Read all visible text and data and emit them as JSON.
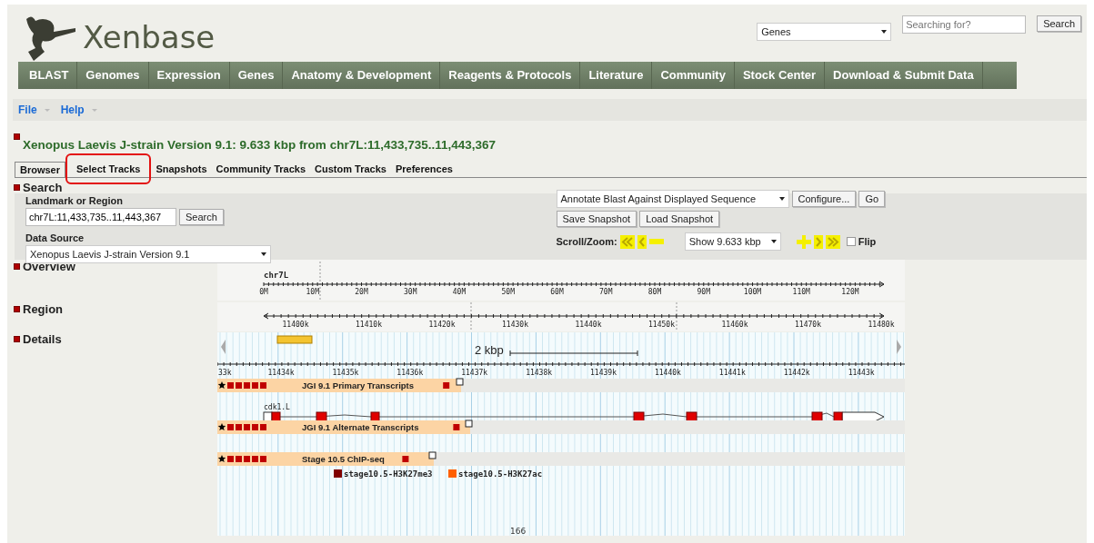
{
  "header": {
    "logo_text": "Xenbase",
    "category": "Genes",
    "search_placeholder": "Searching for?",
    "search_button": "Search"
  },
  "nav": [
    "BLAST",
    "Genomes",
    "Expression",
    "Genes",
    "Anatomy & Development",
    "Reagents & Protocols",
    "Literature",
    "Community",
    "Stock Center",
    "Download & Submit Data"
  ],
  "menu": [
    "File",
    "Help"
  ],
  "title": "Xenopus Laevis J-strain Version 9.1: 9.633 kbp from chr7L:11,433,735..11,443,367",
  "tabs": [
    {
      "label": "Browser",
      "selected": true,
      "highlighted": false
    },
    {
      "label": "Select Tracks",
      "selected": false,
      "highlighted": true
    },
    {
      "label": "Snapshots",
      "selected": false,
      "highlighted": false
    },
    {
      "label": "Community Tracks",
      "selected": false,
      "highlighted": false
    },
    {
      "label": "Custom Tracks",
      "selected": false,
      "highlighted": false
    },
    {
      "label": "Preferences",
      "selected": false,
      "highlighted": false
    }
  ],
  "search": {
    "title": "Search",
    "landmark_label": "Landmark or Region",
    "landmark_value": "chr7L:11,433,735..11,443,367",
    "search_button": "Search",
    "source_label": "Data Source",
    "source_value": "Xenopus Laevis J-strain Version 9.1",
    "annotate_value": "Annotate Blast Against Displayed Sequence",
    "configure_button": "Configure...",
    "go_button": "Go",
    "save_button": "Save Snapshot",
    "load_button": "Load Snapshot",
    "scroll_label": "Scroll/Zoom:",
    "zoom_value": "Show 9.633 kbp",
    "flip_label": "Flip",
    "flip_checked": false
  },
  "overview": {
    "title": "Overview",
    "chromosome": "chr7L",
    "ticks": [
      "0M",
      "10M",
      "20M",
      "30M",
      "40M",
      "50M",
      "60M",
      "70M",
      "80M",
      "90M",
      "100M",
      "110M",
      "120M"
    ]
  },
  "region": {
    "title": "Region",
    "ticks": [
      "11400k",
      "11410k",
      "11420k",
      "11430k",
      "11440k",
      "11450k",
      "11460k",
      "11470k",
      "11480k"
    ]
  },
  "details": {
    "title": "Details",
    "scale_label": "2 kbp",
    "ticks": [
      "33k",
      "11434k",
      "11435k",
      "11436k",
      "11437k",
      "11438k",
      "11439k",
      "11440k",
      "11441k",
      "11442k",
      "11443k"
    ],
    "tracks": [
      {
        "name": "JGI 9.1 Primary Transcripts",
        "kind": "gene",
        "gene_label": "cdk1.L"
      },
      {
        "name": "JGI 9.1 Alternate Transcripts",
        "kind": "empty"
      },
      {
        "name": "Stage 10.5 ChIP-seq",
        "kind": "legend",
        "legend": [
          {
            "label": "stage10.5-H3K27me3",
            "color": "#800000"
          },
          {
            "label": "stage10.5-H3K27ac",
            "color": "#ff6000"
          }
        ]
      }
    ],
    "bottom_label": "166"
  }
}
